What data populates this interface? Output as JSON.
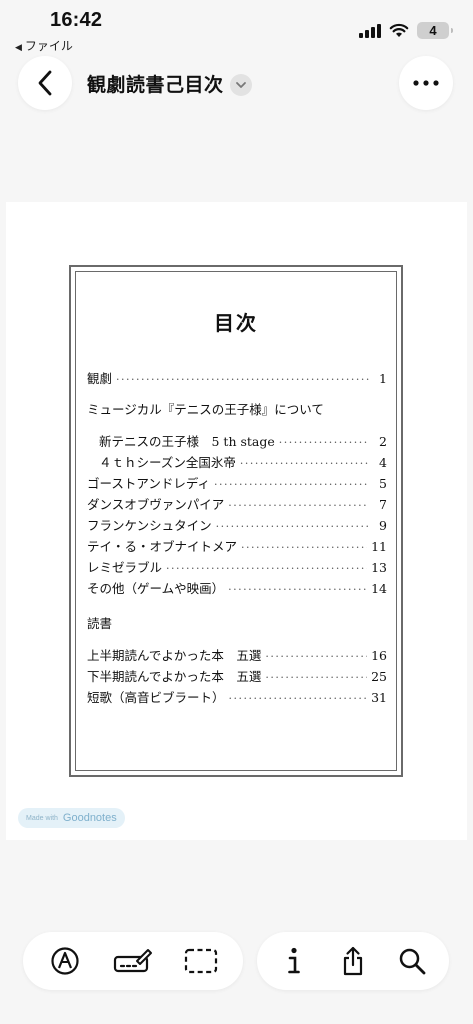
{
  "status_bar": {
    "time": "16:42",
    "back_app_label": "ファイル",
    "battery": "4"
  },
  "header": {
    "title": "観劇読書己目次"
  },
  "page": {
    "heading": "目次",
    "sections": [
      {
        "label": "観劇",
        "page": "1"
      },
      {
        "label": "ミュージカル『テニスの王子様』について"
      },
      {
        "label": "新テニスの王子様　5 th stage",
        "page": "2"
      },
      {
        "label": "４ｔｈシーズン全国氷帝",
        "page": "4"
      },
      {
        "label": "ゴーストアンドレディ",
        "page": "5"
      },
      {
        "label": "ダンスオブヴァンパイア",
        "page": "7"
      },
      {
        "label": "フランケンシュタイン",
        "page": "9"
      },
      {
        "label": "テイ・る・オブナイトメア",
        "page": "11"
      },
      {
        "label": "レミゼラブル",
        "page": "13"
      },
      {
        "label": "その他（ゲームや映画）",
        "page": "14"
      },
      {
        "label": "読書"
      },
      {
        "label": "上半期読んでよかった本　五選",
        "page": "16"
      },
      {
        "label": "下半期読んでよかった本　五選",
        "page": "25"
      },
      {
        "label": "短歌（高音ビブラート）",
        "page": "31"
      }
    ],
    "made_with_prefix": "Made with",
    "made_with_brand": "Goodnotes"
  },
  "toolbar": {
    "icons": [
      "pen-icon",
      "pencil-ruler-icon",
      "lasso-select-icon",
      "info-icon",
      "share-icon",
      "search-icon"
    ]
  },
  "colors": {
    "background": "#f6f6f6",
    "page": "#ffffff",
    "frame": "#6a6a6a",
    "badge_bg": "#e4f1f8",
    "badge_text": "#7fb0cc"
  }
}
